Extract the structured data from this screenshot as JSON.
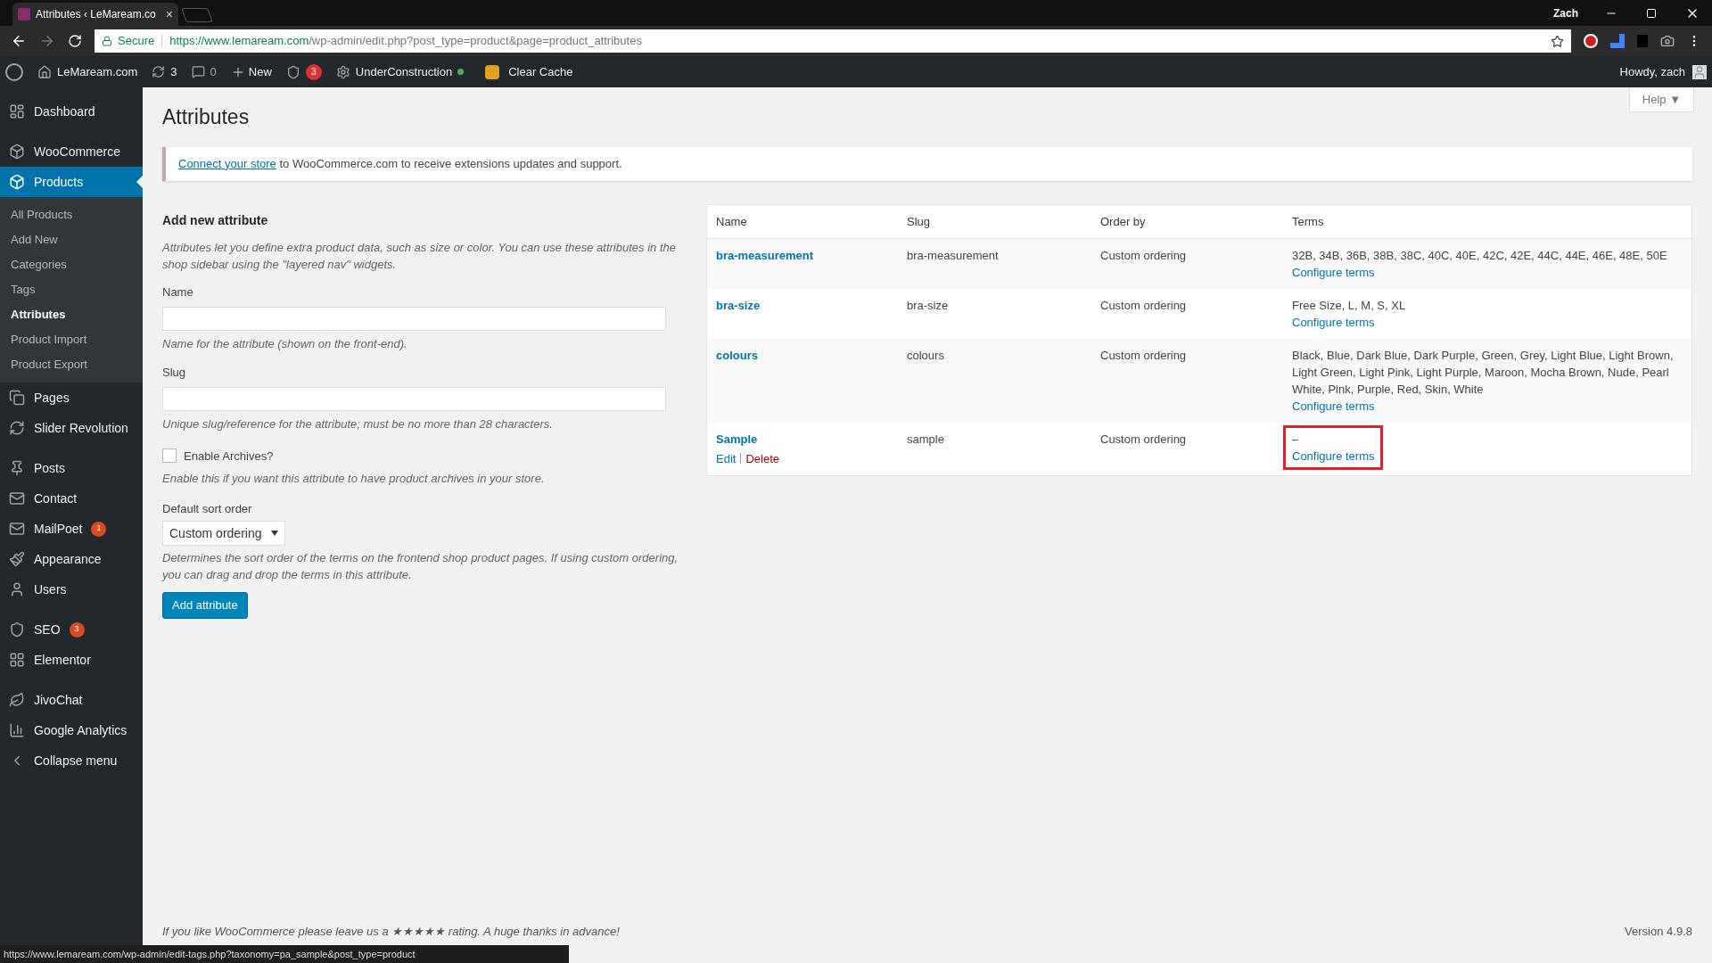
{
  "browser": {
    "tab_title": "Attributes ‹ LeMaream.co",
    "tab_close": "×",
    "profile": "Zach",
    "secure_label": "Secure",
    "url_host": "https://www.lemaream.com",
    "url_path": "/wp-admin/edit.php?post_type=product&page=product_attributes"
  },
  "admin_bar": {
    "site": "LeMaream.com",
    "updates": "3",
    "comments": "0",
    "new": "New",
    "yoast_count": "3",
    "maintenance": "UnderConstruction",
    "maintenance_on": true,
    "cache": "Clear Cache",
    "greeting": "Howdy, zach"
  },
  "sidebar": {
    "groups": [
      [
        {
          "label": "Dashboard",
          "selected": false
        }
      ],
      [
        {
          "label": "WooCommerce",
          "selected": false
        },
        {
          "label": "Products",
          "selected": true,
          "children": [
            {
              "label": "All Products",
              "selected": false
            },
            {
              "label": "Add New",
              "selected": false
            },
            {
              "label": "Categories",
              "selected": false
            },
            {
              "label": "Tags",
              "selected": false
            },
            {
              "label": "Attributes",
              "selected": true
            },
            {
              "label": "Product Import",
              "selected": false
            },
            {
              "label": "Product Export",
              "selected": false
            }
          ]
        },
        {
          "label": "Pages",
          "selected": false
        },
        {
          "label": "Slider Revolution",
          "selected": false
        }
      ],
      [
        {
          "label": "Posts",
          "selected": false
        },
        {
          "label": "Contact",
          "selected": false
        },
        {
          "label": "MailPoet",
          "selected": false,
          "badge": "1"
        },
        {
          "label": "Appearance",
          "selected": false
        },
        {
          "label": "Users",
          "selected": false
        }
      ],
      [
        {
          "label": "SEO",
          "selected": false,
          "badge": "3"
        },
        {
          "label": "Elementor",
          "selected": false
        }
      ],
      [
        {
          "label": "JivoChat",
          "selected": false
        },
        {
          "label": "Google Analytics",
          "selected": false
        },
        {
          "label": "Collapse menu",
          "selected": false
        }
      ]
    ]
  },
  "help_button": "Help ▼",
  "page_title": "Attributes",
  "notice": {
    "link": "Connect your store",
    "text": " to WooCommerce.com to receive extensions updates and support."
  },
  "form": {
    "heading": "Add new attribute",
    "intro": "Attributes let you define extra product data, such as size or color. You can use these attributes in the shop sidebar using the \"layered nav\" widgets.",
    "fields": [
      {
        "label": "Name",
        "help": "Name for the attribute (shown on the front-end)."
      },
      {
        "label": "Slug",
        "help": "Unique slug/reference for the attribute; must be no more than 28 characters."
      }
    ],
    "archives": {
      "label": "Enable Archives?",
      "checked": false,
      "help": "Enable this if you want this attribute to have product archives in your store."
    },
    "sort": {
      "label": "Default sort order",
      "value": "Custom ordering",
      "help": "Determines the sort order of the terms on the frontend shop product pages. If using custom ordering, you can drag and drop the terms in this attribute."
    },
    "submit": "Add attribute"
  },
  "table": {
    "columns": [
      "Name",
      "Slug",
      "Order by",
      "Terms"
    ],
    "rows": [
      {
        "name": "bra-measurement",
        "slug": "bra-measurement",
        "order_by": "Custom ordering",
        "terms": "32B, 34B, 36B, 38B, 38C, 40C, 40E, 42C, 42E, 44C, 44E, 46E, 48E, 50E",
        "configure": "Configure terms",
        "highlighted": false
      },
      {
        "name": "bra-size",
        "slug": "bra-size",
        "order_by": "Custom ordering",
        "terms": "Free Size, L, M, S, XL",
        "configure": "Configure terms",
        "highlighted": false
      },
      {
        "name": "colours",
        "slug": "colours",
        "order_by": "Custom ordering",
        "terms": "Black, Blue, Dark Blue, Dark Purple, Green, Grey, Light Blue, Light Brown, Light Green, Light Pink, Light Purple, Maroon, Mocha Brown, Nude, Pearl White, Pink, Purple, Red, Skin, White",
        "configure": "Configure terms",
        "highlighted": false
      },
      {
        "name": "Sample",
        "slug": "sample",
        "order_by": "Custom ordering",
        "terms": "–",
        "configure": "Configure terms",
        "highlighted": true,
        "actions": [
          "Edit",
          "Delete"
        ]
      }
    ]
  },
  "footer": {
    "thanks": "If you like WooCommerce please leave us a ★★★★★ rating. A huge thanks in advance!",
    "version": "Version 4.9.8"
  },
  "status_url": "https://www.lemaream.com/wp-admin/edit-tags.php?taxonomy=pa_sample&post_type=product"
}
